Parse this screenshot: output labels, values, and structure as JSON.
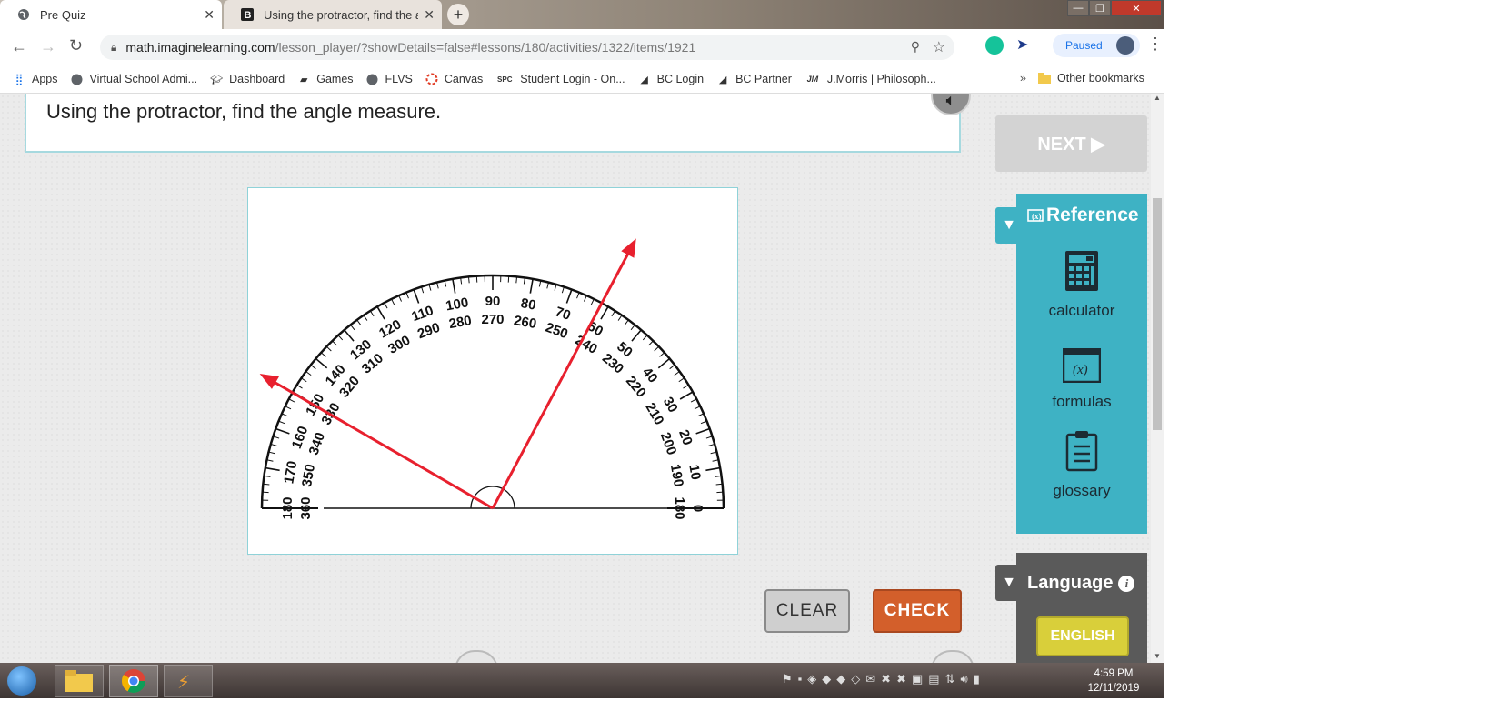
{
  "browser": {
    "tabs": [
      {
        "label": "Pre Quiz",
        "active": true
      },
      {
        "label": "Using the protractor, find the an",
        "active": false
      }
    ],
    "url_host": "math.imaginelearning.com",
    "url_path": "/lesson_player/?showDetails=false#lessons/180/activities/1322/items/1921",
    "profile_status": "Paused",
    "bookmarks": [
      {
        "label": "Apps",
        "icon": "apps-grid-icon"
      },
      {
        "label": "Virtual School Admi...",
        "icon": "globe-icon"
      },
      {
        "label": "Dashboard",
        "icon": "graduation-cap-icon"
      },
      {
        "label": "Games",
        "icon": "gamepad-icon"
      },
      {
        "label": "FLVS",
        "icon": "globe-icon"
      },
      {
        "label": "Canvas",
        "icon": "canvas-icon"
      },
      {
        "label": "Student Login - On...",
        "icon": "spc-icon"
      },
      {
        "label": "BC Login",
        "icon": "bc-icon"
      },
      {
        "label": "BC Partner",
        "icon": "bc-icon"
      },
      {
        "label": "J.Morris | Philosoph...",
        "icon": "jm-icon"
      }
    ],
    "other_bookmarks": "Other bookmarks",
    "overflow": "»"
  },
  "page": {
    "question": "Using the protractor, find the angle measure.",
    "next_label": "NEXT ▶",
    "reference_title": "Reference",
    "reference_items": [
      "calculator",
      "formulas",
      "glossary"
    ],
    "language_title": "Language",
    "language_button": "ENGLISH",
    "clear_label": "CLEAR",
    "check_label": "CHECK"
  },
  "protractor": {
    "outer_scale": [
      "0",
      "10",
      "20",
      "30",
      "40",
      "50",
      "60",
      "70",
      "80",
      "90",
      "100",
      "110",
      "120",
      "130",
      "140",
      "150",
      "160",
      "170",
      "180"
    ],
    "inner_scale": [
      "180",
      "190",
      "200",
      "210",
      "220",
      "230",
      "240",
      "250",
      "260",
      "270",
      "280",
      "290",
      "300",
      "310",
      "320",
      "330",
      "340",
      "350",
      "360"
    ],
    "ray_angles_deg": [
      150,
      62
    ],
    "ray_color": "#e8202e"
  },
  "taskbar": {
    "time": "4:59 PM",
    "date": "12/11/2019"
  },
  "colors": {
    "accent_teal": "#3eb2c4",
    "check_orange": "#d35f2b",
    "english_yellow": "#d9cf3a"
  }
}
